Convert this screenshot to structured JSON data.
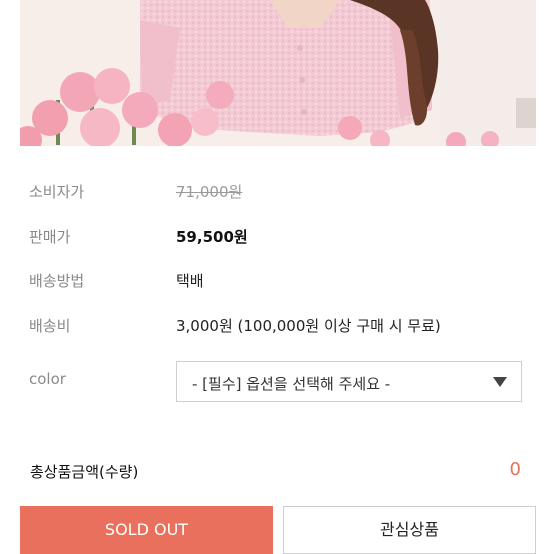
{
  "product_image": {
    "alt": "pink fuzzy knit top with carnations"
  },
  "info": [
    {
      "label": "소비자가",
      "value": "71,000원"
    },
    {
      "label": "판매가",
      "value": "59,500원"
    },
    {
      "label": "배송방법",
      "value": "택배"
    },
    {
      "label": "배송비",
      "value": "3,000원 (100,000원 이상 구매 시 무료)"
    }
  ],
  "option": {
    "label": "color",
    "selected": "- [필수] 옵션을 선택해 주세요 -"
  },
  "total": {
    "label": "총상품금액(수량)",
    "count": "0"
  },
  "buttons": {
    "sold_out": "SOLD OUT",
    "wishlist": "관심상품"
  },
  "colors": {
    "accent": "#e8705c",
    "photo_bg": "#f7eeea",
    "knit": "#f3c9d3"
  }
}
